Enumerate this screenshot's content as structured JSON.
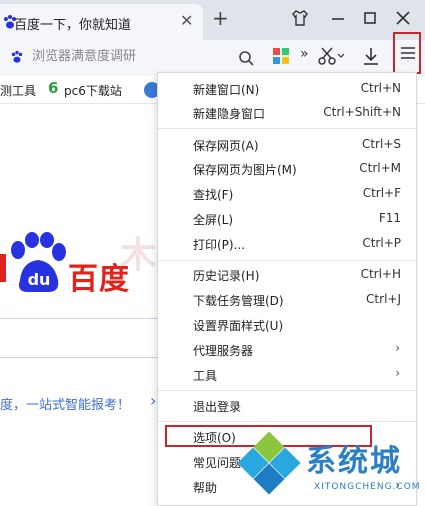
{
  "tab": {
    "title": "百度一下，你就知道",
    "close": "✕"
  },
  "new_tab": "+",
  "search": {
    "placeholder": "浏览器满意度调研"
  },
  "toolbar": {
    "more_chevron": "»"
  },
  "bookmarks": [
    {
      "label": "测工具"
    },
    {
      "label": "pc6下载站"
    }
  ],
  "page": {
    "logo_text": "百度",
    "promo": "度，一站式智能报考！",
    "promo_chevron": "›",
    "watermark": "木星教程网"
  },
  "menu": {
    "items": [
      {
        "label": "新建窗口(N)",
        "shortcut": "Ctrl+N"
      },
      {
        "label": "新建隐身窗口",
        "shortcut": "Ctrl+Shift+N"
      },
      {
        "label": "保存网页(A)",
        "shortcut": "Ctrl+S"
      },
      {
        "label": "保存网页为图片(M)",
        "shortcut": "Ctrl+M"
      },
      {
        "label": "查找(F)",
        "shortcut": "Ctrl+F"
      },
      {
        "label": "全屏(L)",
        "shortcut": "F11"
      },
      {
        "label": "打印(P)...",
        "shortcut": "Ctrl+P"
      },
      {
        "label": "历史记录(H)",
        "shortcut": "Ctrl+H"
      },
      {
        "label": "下载任务管理(D)",
        "shortcut": "Ctrl+J"
      },
      {
        "label": "设置界面样式(U)",
        "shortcut": ""
      },
      {
        "label": "代理服务器",
        "arrow": "›"
      },
      {
        "label": "工具",
        "arrow": "›"
      },
      {
        "label": "退出登录",
        "shortcut": ""
      },
      {
        "label": "选项(O)",
        "shortcut": ""
      },
      {
        "label": "常见问题",
        "shortcut": ""
      },
      {
        "label": "帮助",
        "arrow": "›"
      }
    ]
  },
  "watermark_logo": {
    "text": "系统城",
    "sub": "XITONGCHENG.COM"
  },
  "colors": {
    "highlight_border": "#c9262b",
    "baidu_red": "#e0231b",
    "baidu_blue": "#2932e1",
    "watermark_blue": "#2a7fc5"
  }
}
